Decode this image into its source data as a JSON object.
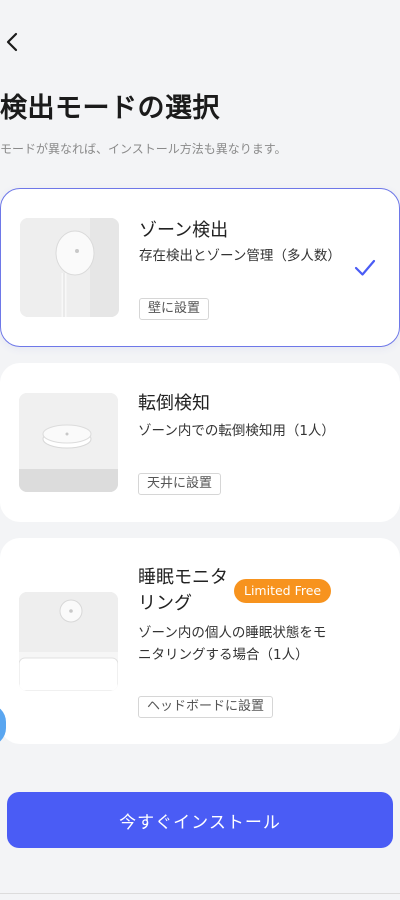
{
  "header": {
    "back_icon": "chevron-left-icon",
    "title": "検出モードの選択",
    "subtitle": "モードが異なれば、インストール方法も異なります。"
  },
  "modes": [
    {
      "title": "ゾーン検出",
      "description": "存在検出とゾーン管理（多人数）",
      "tag": "壁に設置",
      "selected": true,
      "thumbnail_icon": "wall-mounted-sensor-image"
    },
    {
      "title": "転倒検知",
      "description": "ゾーン内での転倒検知用（1人）",
      "tag": "天井に設置",
      "selected": false,
      "thumbnail_icon": "ceiling-sensor-image"
    },
    {
      "title": "睡眠モニタリング",
      "badge": "Limited Free",
      "description": "ゾーン内の個人の睡眠状態をモニタリングする場合（1人）",
      "tag": "ヘッドボードに設置",
      "selected": false,
      "thumbnail_icon": "headboard-sensor-image"
    }
  ],
  "footer": {
    "install_label": "今すぐインストール"
  },
  "colors": {
    "accent": "#4a5cf5",
    "selected_border": "#6e78e8",
    "badge": "#f7931e",
    "background": "#f3f4f6"
  }
}
